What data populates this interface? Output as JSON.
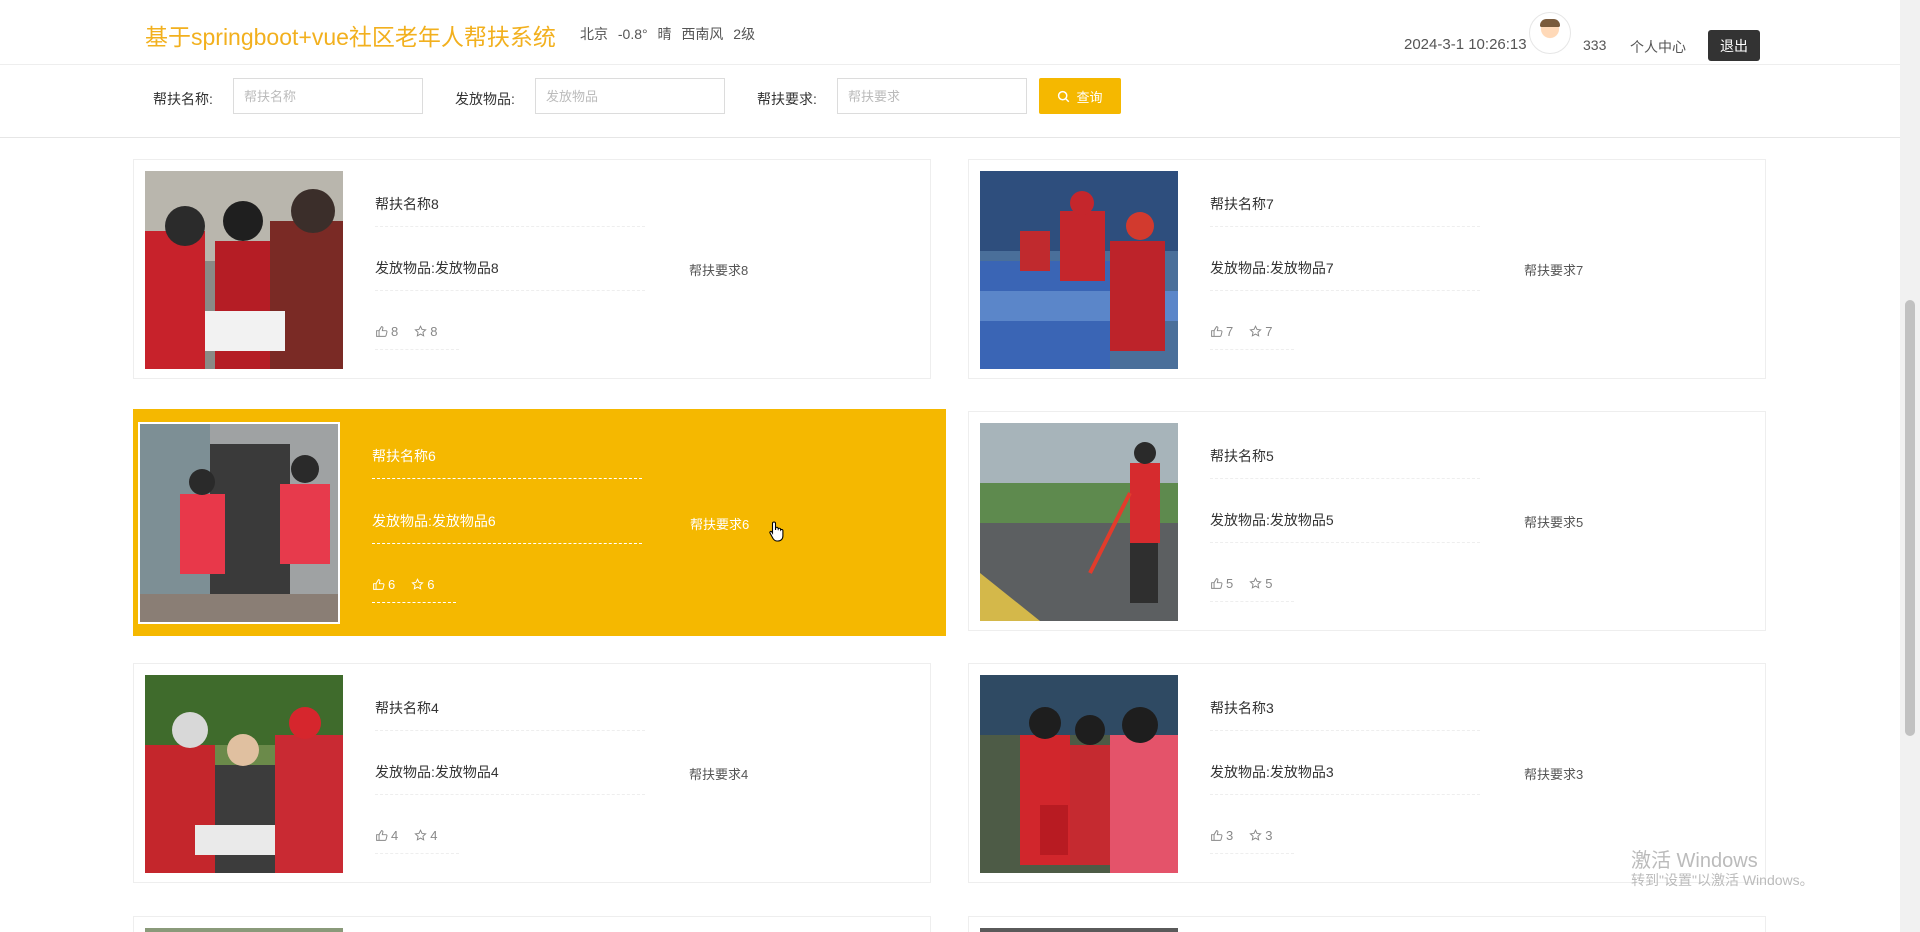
{
  "header": {
    "title": "基于springboot+vue社区老年人帮扶系统",
    "weather": "北京 -0.8° 晴 西南风 2级",
    "datetime": "2024-3-1 10:26:13",
    "username": "333",
    "user_center": "个人中心",
    "logout": "退出"
  },
  "search": {
    "name_label": "帮扶名称:",
    "name_placeholder": "帮扶名称",
    "goods_label": "发放物品:",
    "goods_placeholder": "发放物品",
    "req_label": "帮扶要求:",
    "req_placeholder": "帮扶要求",
    "query_label": "查询"
  },
  "cards": [
    {
      "name": "帮扶名称8",
      "goods": "发放物品:发放物品8",
      "req": "帮扶要求8",
      "likes": "8",
      "favs": "8"
    },
    {
      "name": "帮扶名称7",
      "goods": "发放物品:发放物品7",
      "req": "帮扶要求7",
      "likes": "7",
      "favs": "7"
    },
    {
      "name": "帮扶名称6",
      "goods": "发放物品:发放物品6",
      "req": "帮扶要求6",
      "likes": "6",
      "favs": "6"
    },
    {
      "name": "帮扶名称5",
      "goods": "发放物品:发放物品5",
      "req": "帮扶要求5",
      "likes": "5",
      "favs": "5"
    },
    {
      "name": "帮扶名称4",
      "goods": "发放物品:发放物品4",
      "req": "帮扶要求4",
      "likes": "4",
      "favs": "4"
    },
    {
      "name": "帮扶名称3",
      "goods": "发放物品:发放物品3",
      "req": "帮扶要求3",
      "likes": "3",
      "favs": "3"
    }
  ],
  "watermark": {
    "title": "激活 Windows",
    "subtitle": "转到\"设置\"以激活 Windows。"
  },
  "colors": {
    "accent": "#f5b800",
    "title": "#f2b01e",
    "logout_bg": "#333333"
  },
  "icons": {
    "like": "thumbs-up-icon",
    "fav": "star-icon",
    "search": "search-icon"
  }
}
